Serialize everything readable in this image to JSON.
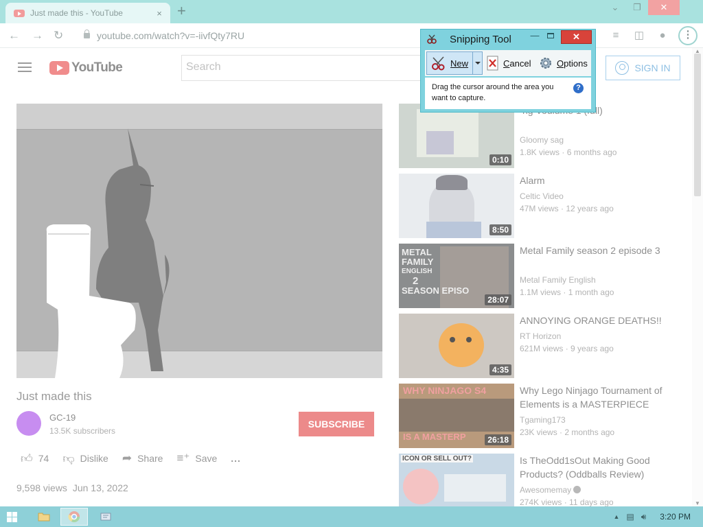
{
  "browser": {
    "tab_title": "Just made this - YouTube",
    "tab_close": "×",
    "new_tab": "+",
    "url": "youtube.com/watch?v=-iivfQty7RU",
    "window_controls": {
      "minimize": "⌄",
      "restore": "❐",
      "close": "✕"
    }
  },
  "youtube": {
    "logo_text": "YouTube",
    "search_placeholder": "Search",
    "sign_in": "SIGN IN",
    "video": {
      "title": "Just made this",
      "channel": "GC-19",
      "subscribers": "13.5K subscribers",
      "subscribe": "SUBSCRIBE",
      "likes": "74",
      "dislike": "Dislike",
      "share": "Share",
      "save": "Save",
      "more": "...",
      "views": "9,598 views",
      "date": "Jun 13, 2022"
    },
    "recommendations": [
      {
        "title": "ng Voulume 1 (full)",
        "channel": "Gloomy sag",
        "views": "1.8K views",
        "age": "6 months ago",
        "duration": "0:10",
        "verified": false
      },
      {
        "title": "Alarm",
        "channel": "Celtic Video",
        "views": "47M views",
        "age": "12 years ago",
        "duration": "8:50",
        "verified": false
      },
      {
        "title": "Metal Family season 2 episode 3",
        "channel": "Metal Family English",
        "views": "1.1M views",
        "age": "1 month ago",
        "duration": "28:07",
        "verified": false,
        "thumb_text": [
          "METAL",
          "FAMILY",
          "ENGLISH",
          "2",
          "SEASON",
          "EPISO"
        ]
      },
      {
        "title": "ANNOYING ORANGE DEATHS!!",
        "channel": "RT Horizon",
        "views": "621M views",
        "age": "9 years ago",
        "duration": "4:35",
        "verified": false
      },
      {
        "title": "Why Lego Ninjago Tournament of Elements is a MASTERPIECE",
        "channel": "Tgaming173",
        "views": "23K views",
        "age": "2 months ago",
        "duration": "26:18",
        "verified": false,
        "thumb_text": [
          "WHY NINJAGO S4",
          "IS A MASTERP"
        ]
      },
      {
        "title": "Is TheOdd1sOut Making Good Products? (Oddballs Review)",
        "channel": "Awesomemay",
        "views": "274K views",
        "age": "11 days ago",
        "duration": "",
        "verified": true,
        "thumb_text": [
          "ICON OR SELL OUT?"
        ]
      }
    ]
  },
  "snipping_tool": {
    "title": "Snipping Tool",
    "new": "New",
    "cancel": "Cancel",
    "options": "Options",
    "instructions": "Drag the cursor around the area you want to capture.",
    "help": "?",
    "close": "✕",
    "minimize": "—"
  },
  "taskbar": {
    "time": "3:20 PM"
  },
  "colors": {
    "chrome_tabbar": "#a9e2df",
    "youtube_red_faded": "#f08c8c",
    "subscribe_faded": "#ec8a8a",
    "snip_frame": "#7fd2de",
    "taskbar": "#8ed0d8"
  }
}
